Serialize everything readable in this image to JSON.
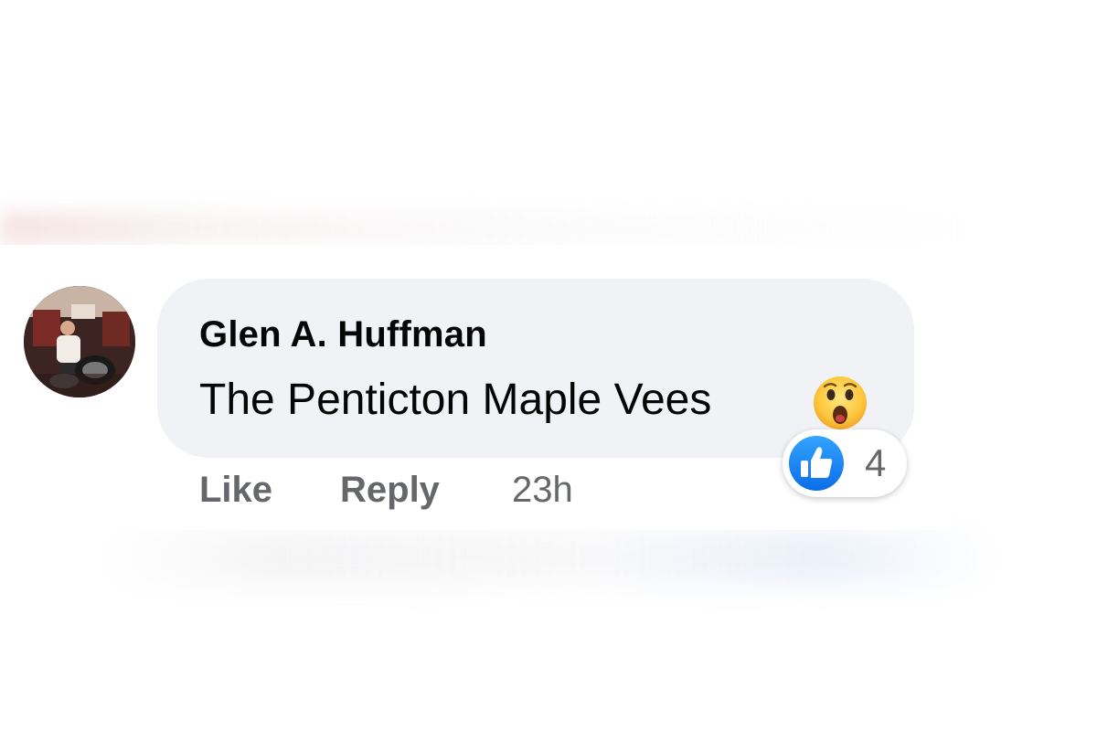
{
  "comment": {
    "author": "Glen A. Huffman",
    "text": "The Penticton Maple Vees",
    "emoji": "astonished-face-icon",
    "avatar": "profile-photo"
  },
  "reactions": {
    "type": "like-icon",
    "count": "4",
    "like_color": "#1877f2"
  },
  "actions": {
    "like_label": "Like",
    "reply_label": "Reply",
    "timestamp": "23h"
  },
  "colors": {
    "bubble": "#f0f2f5",
    "text": "#050505",
    "secondary_text": "#65676b",
    "accent": "#1877f2"
  }
}
